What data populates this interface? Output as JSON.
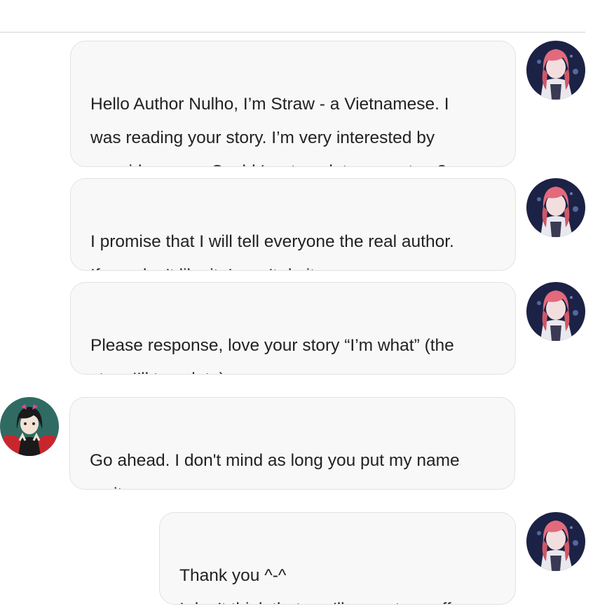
{
  "messages": [
    {
      "sender": "reader",
      "text": "Hello Author Nulho, I’m Straw - a Vietnamese. I\nwas reading your story. I’m very interested by\nyour idea so…. Could I re-translate your story?"
    },
    {
      "sender": "reader",
      "text": "I promise that I will tell everyone the real author.\nIf you don’t like it, I won’t do it"
    },
    {
      "sender": "reader",
      "text": "Please response, love your story “I’m what” (the\nstory I’ll translate)"
    },
    {
      "sender": "author",
      "text": "Go ahead. I don't mind as long you put my name\non it."
    },
    {
      "sender": "reader",
      "text": "Thank you ^-^\nI don’t think that you’ll accept my offer"
    }
  ],
  "avatars": {
    "reader": {
      "icon": "pink-haired-girl-avatar",
      "colors": {
        "background": "#1c2245",
        "hair": "#e26a7c",
        "skin": "#f3dede"
      }
    },
    "author": {
      "icon": "dark-haired-girl-avatar",
      "colors": {
        "background": "#2f6b62",
        "hair": "#1a1a1a",
        "accent": "#c8262e"
      }
    }
  },
  "colors": {
    "bubble_bg": "#f8f8f8",
    "bubble_border": "#e2e2e2",
    "text": "#222222",
    "divider": "#e6e6e6"
  }
}
